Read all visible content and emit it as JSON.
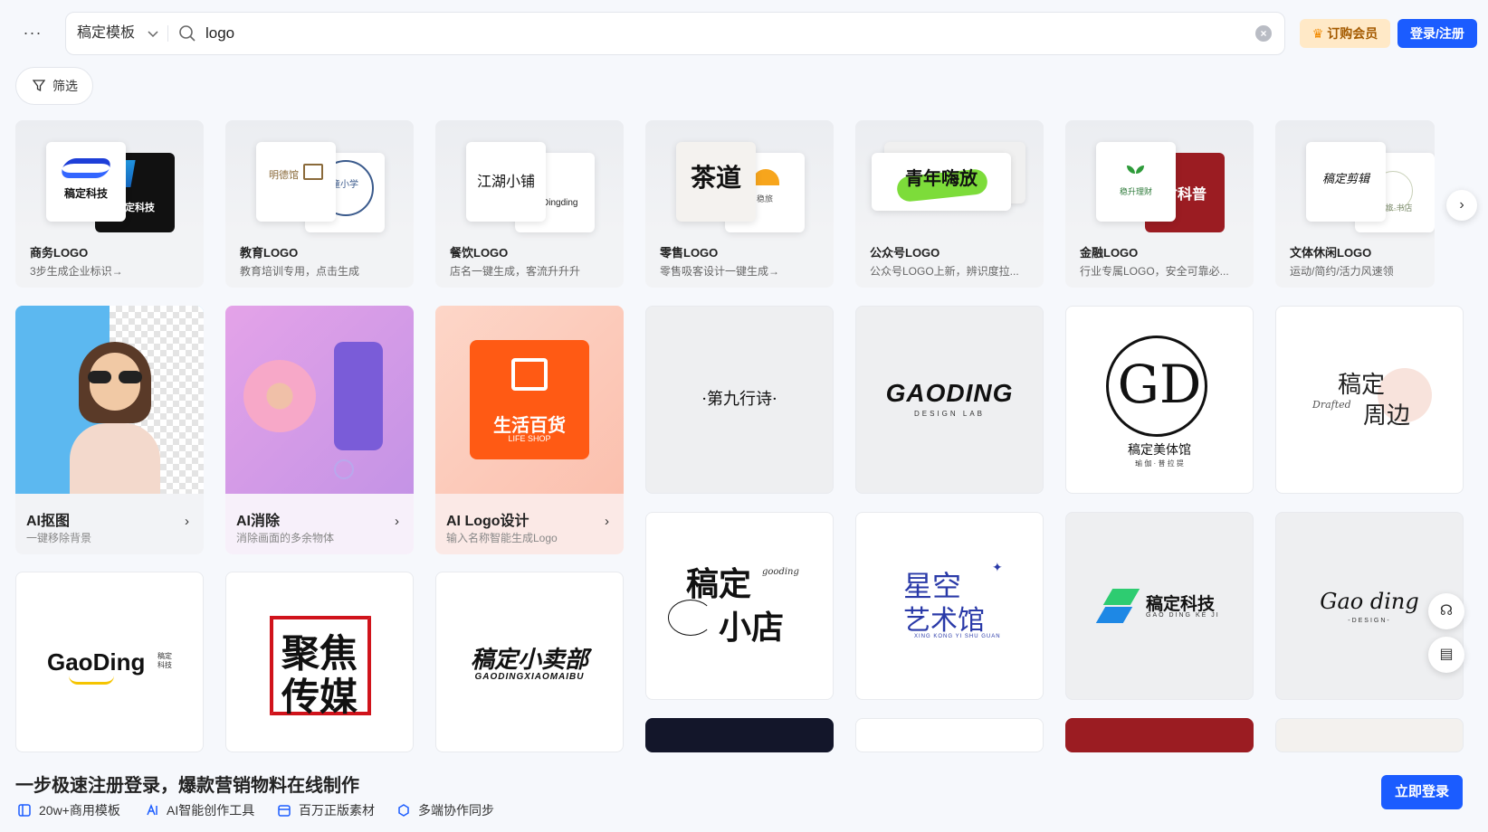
{
  "topbar": {
    "more_label": "···",
    "scope_label": "稿定模板",
    "search_value": "logo",
    "vip_label": "订购会员",
    "login_label": "登录/注册"
  },
  "filter": {
    "label": "筛选"
  },
  "categories": [
    {
      "title": "商务LOGO",
      "sub": "3步生成企业标识→",
      "front_text": "稿定科技",
      "back_color": "#111111",
      "back_text": "稿定科技"
    },
    {
      "title": "教育LOGO",
      "sub": "教育培训专用，点击生成",
      "front_text": "明德馆",
      "back_color": "#ffffff",
      "back_text": "童小学"
    },
    {
      "title": "餐饮LOGO",
      "sub": "店名一键生成，客流升升升",
      "front_text": "江湖小铺",
      "back_color": "#ffffff",
      "back_text": "Dingding"
    },
    {
      "title": "零售LOGO",
      "sub": "零售吸客设计一键生成→",
      "front_text": "茶道",
      "back_color": "#ffffff",
      "back_text": "稳旅"
    },
    {
      "title": "公众号LOGO",
      "sub": "公众号LOGO上新，辨识度拉...",
      "front_text": "青年嗨放",
      "back_color": "#f0f0f0",
      "back_text": ""
    },
    {
      "title": "金融LOGO",
      "sub": "行业专属LOGO，安全可靠必...",
      "front_text": "稳升理财",
      "back_color": "#9b1c22",
      "back_text": "财科普"
    },
    {
      "title": "文体休闲LOGO",
      "sub": "运动/简约/活力风速领",
      "front_text": "稿定剪辑",
      "back_color": "#ffffff",
      "back_text": "稳旅·书店"
    }
  ],
  "tools": [
    {
      "title": "AI抠图",
      "sub": "一键移除背景"
    },
    {
      "title": "AI消除",
      "sub": "消除画面的多余物体"
    },
    {
      "title": "AI Logo设计",
      "sub": "输入名称智能生成Logo",
      "badge_cn": "生活百货",
      "badge_en": "LIFE SHOP"
    }
  ],
  "templates": {
    "t1": "·第九行诗·",
    "t2_main": "GAODING",
    "t2_sub": "DESIGN LAB",
    "t3_letters": "GD",
    "t3_name": "稿定美体馆",
    "t3_sub": "瑜 伽 · 普 拉 提",
    "t4_a": "稿定",
    "t4_b": "周边",
    "t4_c": "Drafted",
    "t5_a": "稿定",
    "t5_b": "小店",
    "t5_c": "gooding",
    "t6_a": "星空",
    "t6_b": "艺术馆",
    "t6_c": "XING KONG YI SHU GUAN",
    "t7_name": "稿定科技",
    "t7_sub": "GAO DING KE JI",
    "t8_main": "Gao ding",
    "t8_sub": "-DESIGN-",
    "t9_main": "GaoDing",
    "t9_side": "稿定科技",
    "t10_a": "聚焦",
    "t10_b": "传媒",
    "t11_main": "稿定小卖部",
    "t11_sub": "GAODINGXIAOMAIBU"
  },
  "banner": {
    "title": "一步极速注册登录，爆款营销物料在线制作",
    "features": [
      "20w+商用模板",
      "AI智能创作工具",
      "百万正版素材",
      "多端协作同步"
    ],
    "login_label": "立即登录"
  },
  "colors": {
    "primary": "#1b5cff",
    "vip_bg": "#ffe9c7",
    "vip_text": "#a45a00"
  }
}
